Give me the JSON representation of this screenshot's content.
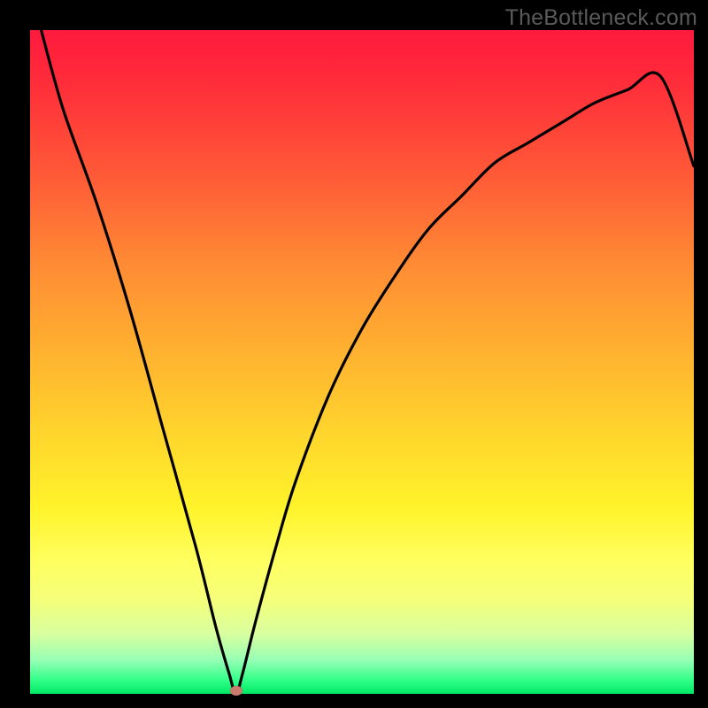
{
  "attribution": "TheBottleneck.com",
  "marker": {
    "x_frac": 0.31,
    "y_frac": 0.996,
    "color": "#c97b6e"
  },
  "chart_data": {
    "type": "line",
    "title": "",
    "xlabel": "",
    "ylabel": "",
    "xlim": [
      0,
      1
    ],
    "ylim": [
      0,
      1
    ],
    "x": [
      0.0,
      0.05,
      0.1,
      0.15,
      0.2,
      0.25,
      0.28,
      0.3,
      0.31,
      0.32,
      0.34,
      0.37,
      0.4,
      0.45,
      0.5,
      0.55,
      0.6,
      0.65,
      0.7,
      0.75,
      0.8,
      0.85,
      0.9,
      0.95,
      1.0
    ],
    "values": [
      1.0,
      0.88,
      0.74,
      0.58,
      0.4,
      0.22,
      0.1,
      0.03,
      0.0,
      0.03,
      0.11,
      0.22,
      0.32,
      0.45,
      0.55,
      0.63,
      0.7,
      0.75,
      0.8,
      0.83,
      0.86,
      0.89,
      0.91,
      0.93,
      0.795
    ],
    "annotations": [
      {
        "text": "TheBottleneck.com",
        "pos": "top-right"
      }
    ],
    "series": [
      {
        "name": "bottleneck-curve",
        "x_ref": "x",
        "y_ref": "values",
        "style": "black-line"
      }
    ],
    "markers": [
      {
        "x": 0.31,
        "y": 0.004,
        "shape": "ellipse",
        "color": "#c97b6e"
      }
    ]
  }
}
